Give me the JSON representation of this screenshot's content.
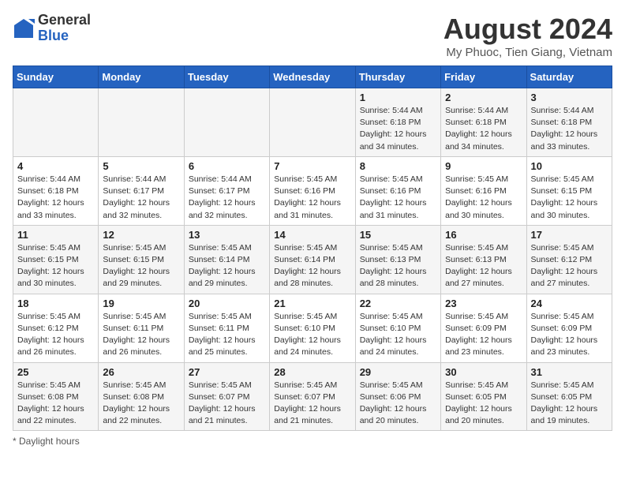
{
  "logo": {
    "general": "General",
    "blue": "Blue"
  },
  "header": {
    "title": "August 2024",
    "subtitle": "My Phuoc, Tien Giang, Vietnam"
  },
  "days_of_week": [
    "Sunday",
    "Monday",
    "Tuesday",
    "Wednesday",
    "Thursday",
    "Friday",
    "Saturday"
  ],
  "weeks": [
    [
      {
        "day": "",
        "info": ""
      },
      {
        "day": "",
        "info": ""
      },
      {
        "day": "",
        "info": ""
      },
      {
        "day": "",
        "info": ""
      },
      {
        "day": "1",
        "info": "Sunrise: 5:44 AM\nSunset: 6:18 PM\nDaylight: 12 hours\nand 34 minutes."
      },
      {
        "day": "2",
        "info": "Sunrise: 5:44 AM\nSunset: 6:18 PM\nDaylight: 12 hours\nand 34 minutes."
      },
      {
        "day": "3",
        "info": "Sunrise: 5:44 AM\nSunset: 6:18 PM\nDaylight: 12 hours\nand 33 minutes."
      }
    ],
    [
      {
        "day": "4",
        "info": "Sunrise: 5:44 AM\nSunset: 6:18 PM\nDaylight: 12 hours\nand 33 minutes."
      },
      {
        "day": "5",
        "info": "Sunrise: 5:44 AM\nSunset: 6:17 PM\nDaylight: 12 hours\nand 32 minutes."
      },
      {
        "day": "6",
        "info": "Sunrise: 5:44 AM\nSunset: 6:17 PM\nDaylight: 12 hours\nand 32 minutes."
      },
      {
        "day": "7",
        "info": "Sunrise: 5:45 AM\nSunset: 6:16 PM\nDaylight: 12 hours\nand 31 minutes."
      },
      {
        "day": "8",
        "info": "Sunrise: 5:45 AM\nSunset: 6:16 PM\nDaylight: 12 hours\nand 31 minutes."
      },
      {
        "day": "9",
        "info": "Sunrise: 5:45 AM\nSunset: 6:16 PM\nDaylight: 12 hours\nand 30 minutes."
      },
      {
        "day": "10",
        "info": "Sunrise: 5:45 AM\nSunset: 6:15 PM\nDaylight: 12 hours\nand 30 minutes."
      }
    ],
    [
      {
        "day": "11",
        "info": "Sunrise: 5:45 AM\nSunset: 6:15 PM\nDaylight: 12 hours\nand 30 minutes."
      },
      {
        "day": "12",
        "info": "Sunrise: 5:45 AM\nSunset: 6:15 PM\nDaylight: 12 hours\nand 29 minutes."
      },
      {
        "day": "13",
        "info": "Sunrise: 5:45 AM\nSunset: 6:14 PM\nDaylight: 12 hours\nand 29 minutes."
      },
      {
        "day": "14",
        "info": "Sunrise: 5:45 AM\nSunset: 6:14 PM\nDaylight: 12 hours\nand 28 minutes."
      },
      {
        "day": "15",
        "info": "Sunrise: 5:45 AM\nSunset: 6:13 PM\nDaylight: 12 hours\nand 28 minutes."
      },
      {
        "day": "16",
        "info": "Sunrise: 5:45 AM\nSunset: 6:13 PM\nDaylight: 12 hours\nand 27 minutes."
      },
      {
        "day": "17",
        "info": "Sunrise: 5:45 AM\nSunset: 6:12 PM\nDaylight: 12 hours\nand 27 minutes."
      }
    ],
    [
      {
        "day": "18",
        "info": "Sunrise: 5:45 AM\nSunset: 6:12 PM\nDaylight: 12 hours\nand 26 minutes."
      },
      {
        "day": "19",
        "info": "Sunrise: 5:45 AM\nSunset: 6:11 PM\nDaylight: 12 hours\nand 26 minutes."
      },
      {
        "day": "20",
        "info": "Sunrise: 5:45 AM\nSunset: 6:11 PM\nDaylight: 12 hours\nand 25 minutes."
      },
      {
        "day": "21",
        "info": "Sunrise: 5:45 AM\nSunset: 6:10 PM\nDaylight: 12 hours\nand 24 minutes."
      },
      {
        "day": "22",
        "info": "Sunrise: 5:45 AM\nSunset: 6:10 PM\nDaylight: 12 hours\nand 24 minutes."
      },
      {
        "day": "23",
        "info": "Sunrise: 5:45 AM\nSunset: 6:09 PM\nDaylight: 12 hours\nand 23 minutes."
      },
      {
        "day": "24",
        "info": "Sunrise: 5:45 AM\nSunset: 6:09 PM\nDaylight: 12 hours\nand 23 minutes."
      }
    ],
    [
      {
        "day": "25",
        "info": "Sunrise: 5:45 AM\nSunset: 6:08 PM\nDaylight: 12 hours\nand 22 minutes."
      },
      {
        "day": "26",
        "info": "Sunrise: 5:45 AM\nSunset: 6:08 PM\nDaylight: 12 hours\nand 22 minutes."
      },
      {
        "day": "27",
        "info": "Sunrise: 5:45 AM\nSunset: 6:07 PM\nDaylight: 12 hours\nand 21 minutes."
      },
      {
        "day": "28",
        "info": "Sunrise: 5:45 AM\nSunset: 6:07 PM\nDaylight: 12 hours\nand 21 minutes."
      },
      {
        "day": "29",
        "info": "Sunrise: 5:45 AM\nSunset: 6:06 PM\nDaylight: 12 hours\nand 20 minutes."
      },
      {
        "day": "30",
        "info": "Sunrise: 5:45 AM\nSunset: 6:05 PM\nDaylight: 12 hours\nand 20 minutes."
      },
      {
        "day": "31",
        "info": "Sunrise: 5:45 AM\nSunset: 6:05 PM\nDaylight: 12 hours\nand 19 minutes."
      }
    ]
  ],
  "footer": {
    "note": "Daylight hours"
  }
}
